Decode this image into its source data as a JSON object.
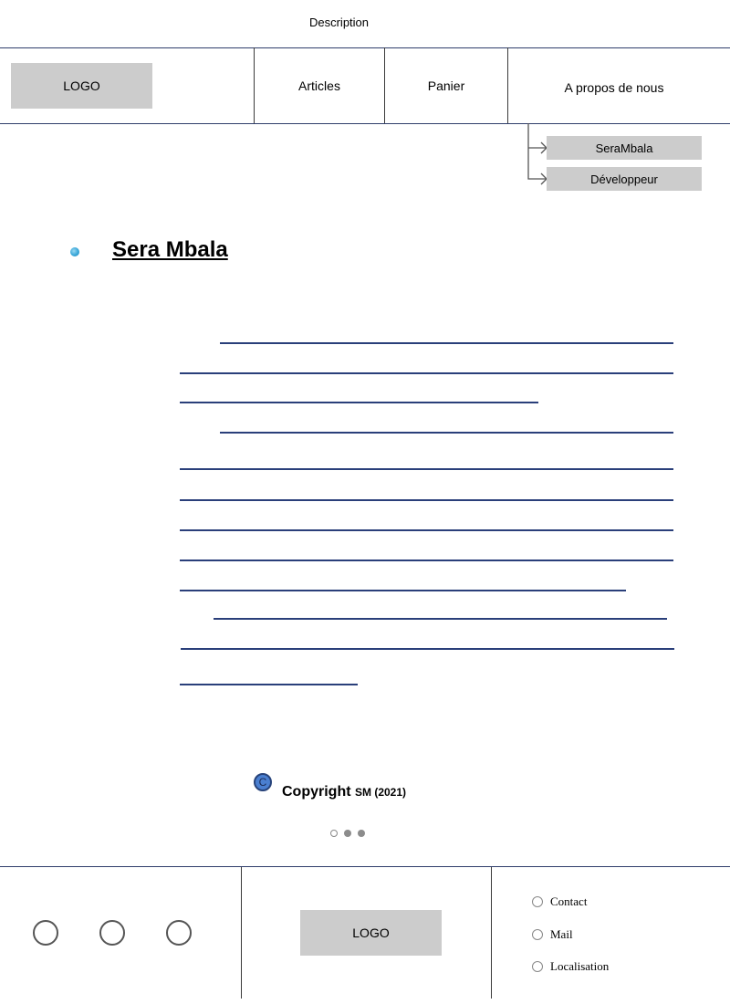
{
  "header": {
    "description": "Description",
    "logo": "LOGO",
    "nav": [
      "Articles",
      "Panier",
      "A propos de nous"
    ],
    "submenu": [
      "SeraMbala",
      "Développeur"
    ]
  },
  "main": {
    "title": "Sera Mbala"
  },
  "copyright": {
    "icon_letter": "C",
    "label": "Copyright",
    "owner": "SM (2021)"
  },
  "carousel": {
    "active_index": 0,
    "count": 3
  },
  "footer": {
    "logo": "LOGO",
    "links": [
      "Contact",
      "Mail",
      "Localisation"
    ]
  }
}
